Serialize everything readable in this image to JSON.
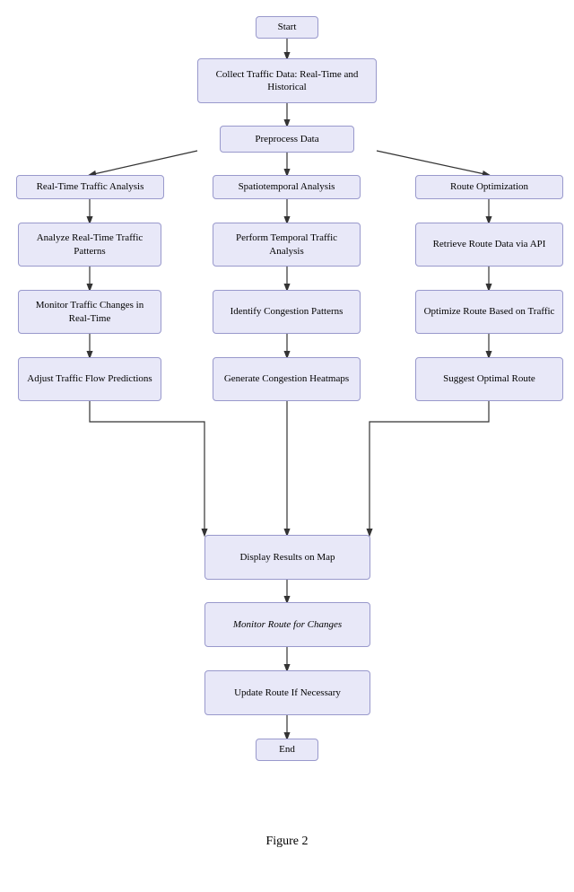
{
  "diagram": {
    "title": "Figure 2",
    "nodes": {
      "start": {
        "label": "Start"
      },
      "collect": {
        "label": "Collect Traffic Data: Real-Time and Historical"
      },
      "preprocess": {
        "label": "Preprocess Data"
      },
      "realtime_analysis": {
        "label": "Real-Time Traffic Analysis"
      },
      "spatiotemporal": {
        "label": "Spatiotemporal Analysis"
      },
      "route_opt": {
        "label": "Route Optimization"
      },
      "analyze_patterns": {
        "label": "Analyze Real-Time Traffic Patterns"
      },
      "temporal_traffic": {
        "label": "Perform Temporal Traffic Analysis"
      },
      "retrieve_route": {
        "label": "Retrieve Route Data via API"
      },
      "monitor_traffic": {
        "label": "Monitor Traffic Changes in Real-Time"
      },
      "identify_congestion": {
        "label": "Identify Congestion Patterns"
      },
      "optimize_route": {
        "label": "Optimize Route Based on Traffic"
      },
      "adjust_flow": {
        "label": "Adjust Traffic Flow Predictions"
      },
      "generate_heatmaps": {
        "label": "Generate Congestion Heatmaps"
      },
      "suggest_route": {
        "label": "Suggest Optimal Route"
      },
      "display_results": {
        "label": "Display Results on Map"
      },
      "monitor_route": {
        "label": "Monitor Route for Changes"
      },
      "update_route": {
        "label": "Update Route If Necessary"
      },
      "end": {
        "label": "End"
      }
    }
  }
}
